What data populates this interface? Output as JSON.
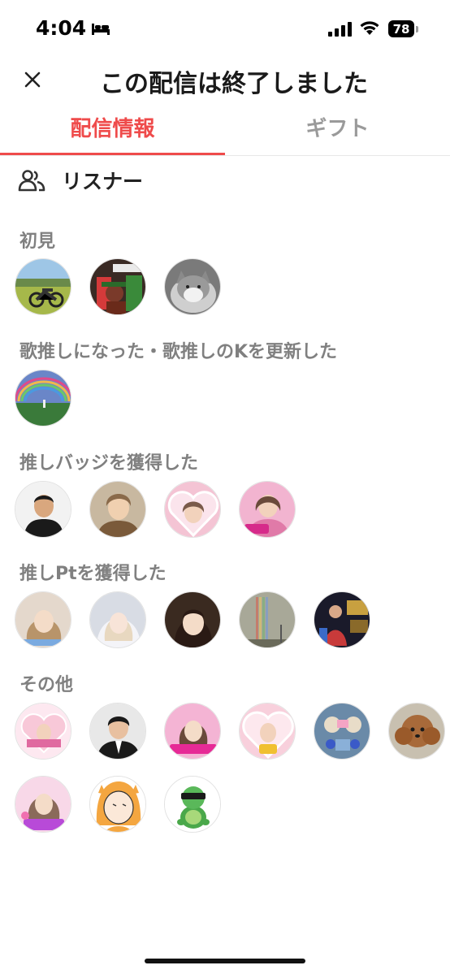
{
  "status_bar": {
    "time": "4:04",
    "battery": "78",
    "icons": [
      "bed-icon",
      "cellular-signal-icon",
      "wifi-icon",
      "battery-icon"
    ]
  },
  "header": {
    "title": "この配信は終了しました",
    "close_icon": "close-icon"
  },
  "tabs": [
    {
      "label": "配信情報",
      "active": true
    },
    {
      "label": "ギフト",
      "active": false
    }
  ],
  "listeners": {
    "title": "リスナー",
    "icon": "people-icon",
    "sections": [
      {
        "label": "初見",
        "avatars": [
          "motorcycle-field",
          "nintendo-world-figure",
          "cat"
        ]
      },
      {
        "label": "歌推しになった・歌推しのKを更新した",
        "avatars": [
          "rainbow-landscape"
        ]
      },
      {
        "label": "推しバッジを獲得した",
        "avatars": [
          "man-black-sweater",
          "young-man-portrait",
          "woman-heart-frame",
          "woman-pink-frame"
        ]
      },
      {
        "label": "推しPtを獲得した",
        "avatars": [
          "woman-blonde",
          "woman-veil",
          "woman-dark-hair",
          "rainbow-sky",
          "person-dark-room"
        ]
      },
      {
        "label": "その他",
        "avatars": [
          "heart-frame-card",
          "man-suit",
          "woman-cheese-pink",
          "woman-heart-pink",
          "plush-toys-blue",
          "poodle-dog",
          "woman-sato-pink",
          "cartoon-girl-hood",
          "turtle-sunglasses"
        ]
      }
    ]
  },
  "colors": {
    "accent": "#ef4b4b",
    "tab_inactive": "#9a9a9a",
    "section_label": "#808080"
  }
}
